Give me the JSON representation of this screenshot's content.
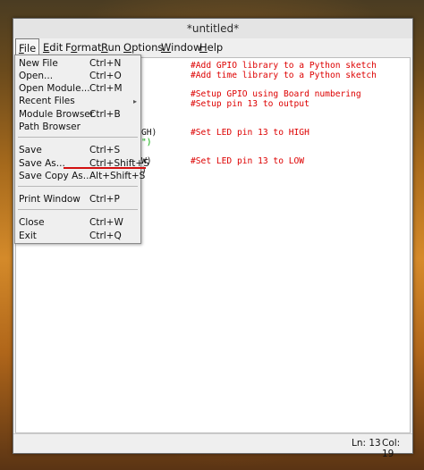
{
  "window": {
    "title": "*untitled*"
  },
  "menubar": {
    "items": [
      {
        "label": "File",
        "active": true
      },
      {
        "label": "Edit"
      },
      {
        "label": "Format"
      },
      {
        "label": "Run"
      },
      {
        "label": "Options"
      },
      {
        "label": "Window"
      },
      {
        "label": "Help"
      }
    ]
  },
  "file_menu": {
    "items": [
      {
        "label": "New File",
        "accel": "Ctrl+N"
      },
      {
        "label": "Open...",
        "accel": "Ctrl+O"
      },
      {
        "label": "Open Module...",
        "accel": "Ctrl+M"
      },
      {
        "label": "Recent Files",
        "accel": ""
      },
      {
        "label": "Module Browser",
        "accel": "Ctrl+B"
      },
      {
        "label": "Path Browser",
        "accel": ""
      },
      {
        "label": "Save",
        "accel": "Ctrl+S"
      },
      {
        "label": "Save As...",
        "accel": "Ctrl+Shift+S"
      },
      {
        "label": "Save Copy As...",
        "accel": "Alt+Shift+S"
      },
      {
        "label": "Print Window",
        "accel": "Ctrl+P"
      },
      {
        "label": "Close",
        "accel": "Ctrl+W"
      },
      {
        "label": "Exit",
        "accel": "Ctrl+Q"
      }
    ],
    "submenu_arrow": "▸"
  },
  "editor": {
    "comments": [
      "#Add GPIO library to a Python sketch",
      "#Add time library to a Python sketch",
      "#Setup GPIO using Board numbering",
      "#Setup pin 13 to output",
      "#Set LED pin 13 to HIGH",
      "#Set LED pin 13 to LOW"
    ],
    "code_fragments": [
      "GH)",
      "\")",
      "W)",
      ")"
    ]
  },
  "status": {
    "line": "Ln: 13",
    "col": "Col: 19"
  },
  "colors": {
    "comment": "#dd0000",
    "string": "#00aa00",
    "underline_marker": "#d21010"
  }
}
